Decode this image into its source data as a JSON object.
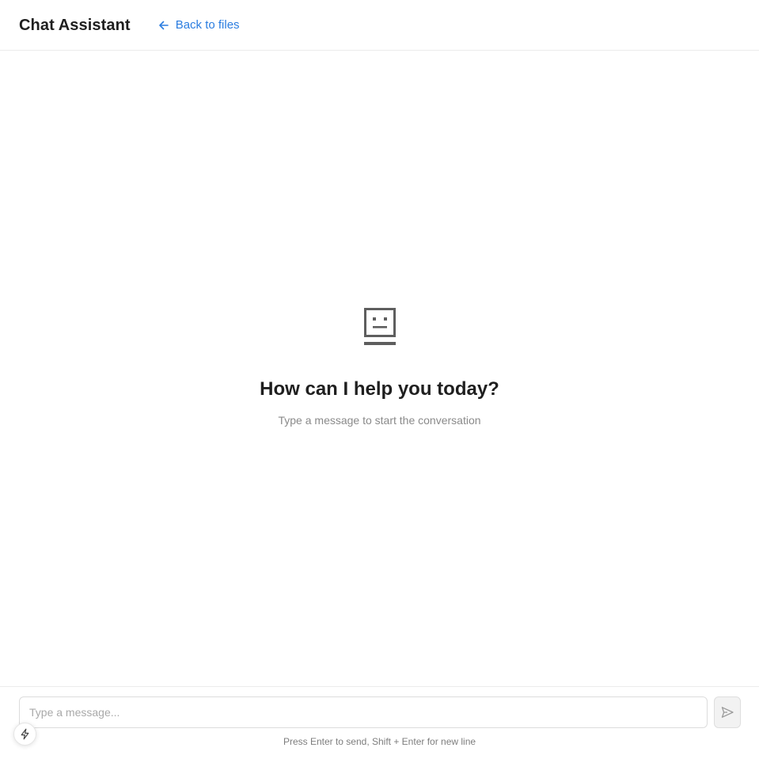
{
  "header": {
    "title": "Chat Assistant",
    "back_link_label": "Back to files",
    "back_icon": "arrow-left-icon",
    "accent_color": "#2b7de0"
  },
  "empty_state": {
    "icon": "robot-face-icon",
    "title": "How can I help you today?",
    "subtitle": "Type a message to start the conversation"
  },
  "composer": {
    "input_value": "",
    "input_placeholder": "Type a message...",
    "send_icon": "send-icon",
    "hint": "Press Enter to send, Shift + Enter for new line"
  },
  "floating_button": {
    "icon": "lightning-bolt-icon"
  }
}
